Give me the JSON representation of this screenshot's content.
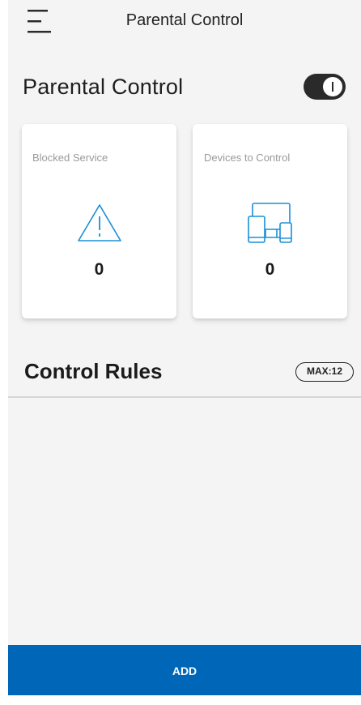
{
  "header": {
    "title": "Parental Control",
    "menu_icon": "menu-icon"
  },
  "parental_control": {
    "heading": "Parental Control",
    "toggle_on": true
  },
  "cards": {
    "blocked_service": {
      "label": "Blocked Service",
      "count": "0",
      "icon": "warning-icon"
    },
    "devices_to_control": {
      "label": "Devices to Control",
      "count": "0",
      "icon": "devices-icon"
    }
  },
  "control_rules": {
    "heading": "Control Rules",
    "max_badge": "MAX:12"
  },
  "footer": {
    "add_label": "ADD"
  },
  "colors": {
    "accent": "#0067b8",
    "icon_blue": "#1a8fd6",
    "background": "#f4f4f4",
    "toggle": "#2a2a2a"
  }
}
